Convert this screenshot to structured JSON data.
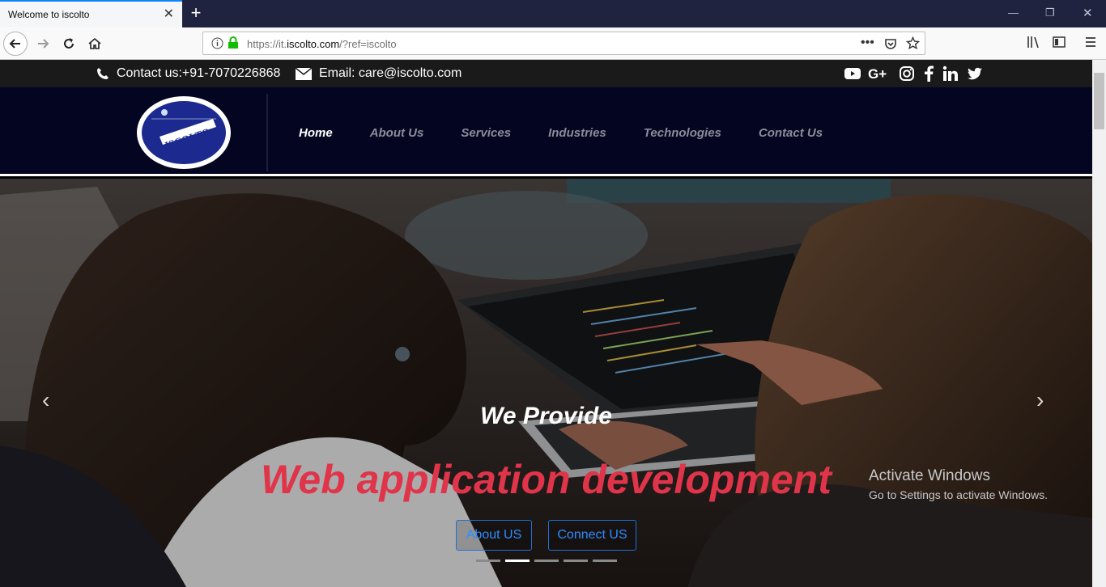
{
  "browser": {
    "tab_title": "Welcome to iscolto",
    "url_prefix": "https://it.",
    "url_domain": "iscolto.com",
    "url_suffix": "/?ref=iscolto"
  },
  "topbar": {
    "phone": "Contact us:+91-7070226868",
    "email": "Email: care@iscolto.com",
    "social_icons": [
      "youtube-icon",
      "google-plus-icon",
      "instagram-icon",
      "facebook-icon",
      "linkedin-icon",
      "twitter-icon"
    ]
  },
  "logo_text": "ISCOLTO",
  "menu": [
    {
      "label": "Home",
      "active": true
    },
    {
      "label": "About Us"
    },
    {
      "label": "Services"
    },
    {
      "label": "Industries"
    },
    {
      "label": "Technologies"
    },
    {
      "label": "Contact Us"
    }
  ],
  "hero": {
    "subtitle": "We Provide",
    "title": "Web application development",
    "button_about": "About US",
    "button_connect": "Connect US",
    "slide_count": 5,
    "active_slide": 2
  },
  "watermark": {
    "line1": "Activate Windows",
    "line2": "Go to Settings to activate Windows."
  },
  "colors": {
    "header_bg": "#040521",
    "accent_red": "#e0344a",
    "button_blue": "#2d8cff"
  }
}
